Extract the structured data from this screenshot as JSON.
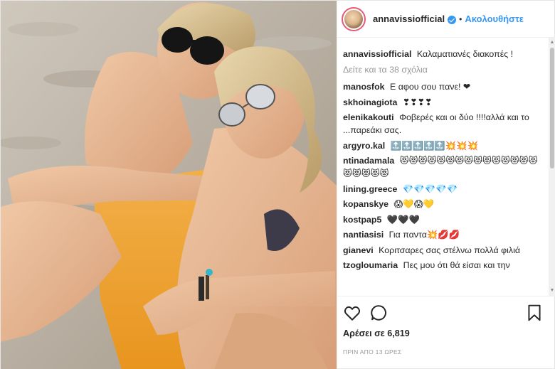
{
  "header": {
    "username": "annavissiofficial",
    "separator": "•",
    "follow_label": "Ακολουθήστε"
  },
  "caption": {
    "user": "annavissiofficial",
    "text": "Καλαματιανές διακοπές !"
  },
  "view_all_comments": "Δείτε και τα 38 σχόλια",
  "comments": [
    {
      "user": "manosfok",
      "text": "Ε αφου σου πανε! ❤"
    },
    {
      "user": "skhoinagiota",
      "text": "❣❣❣❣"
    },
    {
      "user": "elenikakouti",
      "text": "Φοβερές και οι δύο !!!!αλλά και το ...παρεάκι σας."
    },
    {
      "user": "argyro.kal",
      "text": "🔝🔝🔝🔝🔝💥💥💥"
    },
    {
      "user": "ntinadamala",
      "text": "😻😻😻😻😻😻😻😻😻😻😻😻😻😻😻😻😻😻😻😻"
    },
    {
      "user": "lining.greece",
      "text": "💎💎💎💎💎"
    },
    {
      "user": "kopanskye",
      "text": "😱💛😱💛"
    },
    {
      "user": "kostpap5",
      "text": "🖤🖤🖤"
    },
    {
      "user": "nantiasisi",
      "text": "Για παντα💥💋💋"
    },
    {
      "user": "gianevi",
      "text": "Κοριτσαρες σας στέλνω πολλά φιλιά"
    },
    {
      "user": "tzogloumaria",
      "text": "Πες μου ότι θά είσαι και την"
    }
  ],
  "icons": {
    "like": "heart-outline-icon",
    "comment": "speech-bubble-icon",
    "save": "bookmark-icon",
    "verified": "verified-badge-icon"
  },
  "likes_text": "Αρέσει σε 6,819",
  "timestamp": "ΠΡΙΝ ΑΠΟ 13 ΩΡΕΣ",
  "colors": {
    "accent": "#3897f0",
    "text": "#262626",
    "muted": "#999999",
    "border": "#efefef"
  }
}
